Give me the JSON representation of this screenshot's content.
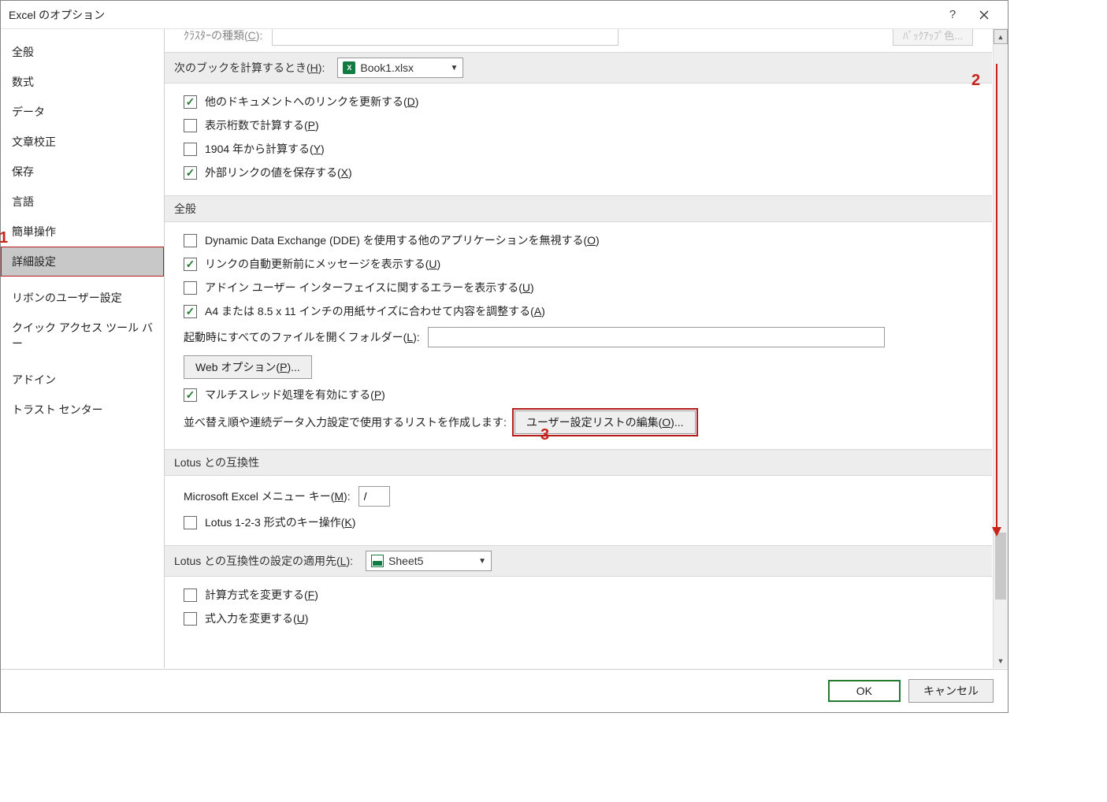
{
  "window": {
    "title": "Excel のオプション"
  },
  "sidebar": {
    "items": [
      {
        "label": "全般"
      },
      {
        "label": "数式"
      },
      {
        "label": "データ"
      },
      {
        "label": "文章校正"
      },
      {
        "label": "保存"
      },
      {
        "label": "言語"
      },
      {
        "label": "簡単操作"
      },
      {
        "label": "詳細設定",
        "selected": true
      },
      {
        "label": "リボンのユーザー設定"
      },
      {
        "label": "クイック アクセス ツール バー"
      },
      {
        "label": "アドイン"
      },
      {
        "label": "トラスト センター"
      }
    ]
  },
  "cutoff": {
    "label_fragment": "ｸﾗｽﾀｰの種類(",
    "label_key": "C",
    "label_close": "):",
    "button": "ﾊﾞｯｸｱｯﾌﾟ色..."
  },
  "sections": {
    "calc_book": {
      "header_pre": "次のブックを計算するとき(",
      "header_key": "H",
      "header_post": "):",
      "combo_value": "Book1.xlsx",
      "items": [
        {
          "pre": "他のドキュメントへのリンクを更新する(",
          "key": "D",
          "post": ")",
          "checked": true
        },
        {
          "pre": "表示桁数で計算する(",
          "key": "P",
          "post": ")",
          "checked": false
        },
        {
          "pre": "1904 年から計算する(",
          "key": "Y",
          "post": ")",
          "checked": false
        },
        {
          "pre": "外部リンクの値を保存する(",
          "key": "X",
          "post": ")",
          "checked": true
        }
      ]
    },
    "general": {
      "header": "全般",
      "items": [
        {
          "pre": "Dynamic Data Exchange (DDE) を使用する他のアプリケーションを無視する(",
          "key": "O",
          "post": ")",
          "checked": false
        },
        {
          "pre": "リンクの自動更新前にメッセージを表示する(",
          "key": "U",
          "post": ")",
          "checked": true
        },
        {
          "pre": "アドイン ユーザー インターフェイスに関するエラーを表示する(",
          "key": "U",
          "post": ")",
          "checked": false
        },
        {
          "pre": "A4 または 8.5 x 11 インチの用紙サイズに合わせて内容を調整する(",
          "key": "A",
          "post": ")",
          "checked": true
        }
      ],
      "startup_pre": "起動時にすべてのファイルを開くフォルダー(",
      "startup_key": "L",
      "startup_post": "):",
      "startup_value": "",
      "web_pre": "Web オプション(",
      "web_key": "P",
      "web_post": ")...",
      "multi_pre": "マルチスレッド処理を有効にする(",
      "multi_key": "P",
      "multi_post": ")",
      "multi_checked": true,
      "list_prompt": "並べ替え順や連続データ入力設定で使用するリストを作成します:",
      "list_btn_pre": "ユーザー設定リストの編集(",
      "list_btn_key": "O",
      "list_btn_post": ")..."
    },
    "lotus1": {
      "header": "Lotus との互換性",
      "menu_pre": "Microsoft Excel メニュー キー(",
      "menu_key": "M",
      "menu_post": "):",
      "menu_value": "/",
      "lotus_key_pre": "Lotus 1-2-3 形式のキー操作(",
      "lotus_key_key": "K",
      "lotus_key_post": ")",
      "lotus_key_checked": false
    },
    "lotus2": {
      "header_pre": "Lotus との互換性の設定の適用先(",
      "header_key": "L",
      "header_post": "):",
      "combo_value": "Sheet5",
      "items": [
        {
          "pre": "計算方式を変更する(",
          "key": "F",
          "post": ")",
          "checked": false
        },
        {
          "pre": "式入力を変更する(",
          "key": "U",
          "post": ")",
          "checked": false
        }
      ]
    }
  },
  "footer": {
    "ok": "OK",
    "cancel": "キャンセル"
  },
  "annotations": {
    "a1": "1",
    "a2": "2",
    "a3": "3"
  }
}
